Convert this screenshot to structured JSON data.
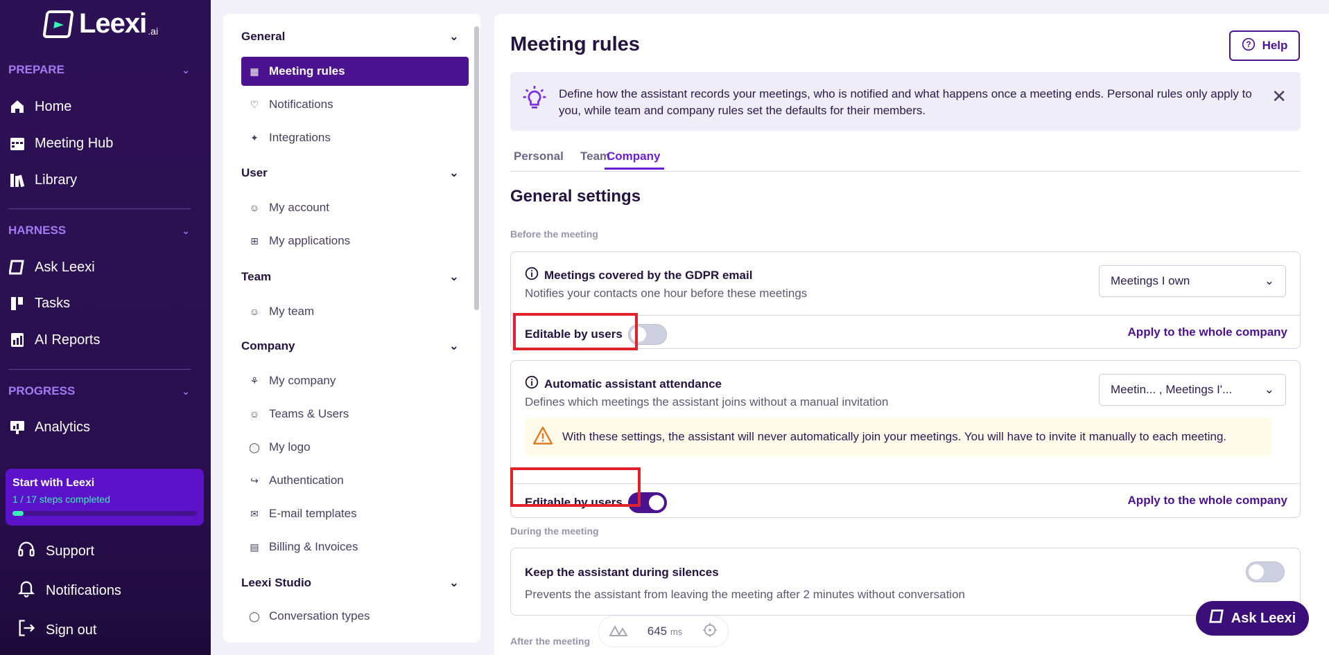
{
  "brand": {
    "name": "Leexi",
    "suffix": ".ai"
  },
  "sidebar": {
    "sections": [
      {
        "label": "PREPARE",
        "items": [
          {
            "label": "Home",
            "icon": "home-icon"
          },
          {
            "label": "Meeting Hub",
            "icon": "calendar-icon"
          },
          {
            "label": "Library",
            "icon": "library-icon"
          }
        ]
      },
      {
        "label": "HARNESS",
        "items": [
          {
            "label": "Ask Leexi",
            "icon": "leexi-icon"
          },
          {
            "label": "Tasks",
            "icon": "tasks-icon"
          },
          {
            "label": "AI Reports",
            "icon": "report-icon"
          }
        ]
      },
      {
        "label": "PROGRESS",
        "items": [
          {
            "label": "Analytics",
            "icon": "analytics-icon"
          }
        ]
      }
    ],
    "start_card": {
      "title": "Start with Leexi",
      "progress_text": "1 / 17 steps completed",
      "progress": 0.06
    },
    "bottom": [
      {
        "label": "Support",
        "icon": "headset-icon"
      },
      {
        "label": "Notifications",
        "icon": "bell-icon"
      },
      {
        "label": "Sign out",
        "icon": "sign-out-icon"
      }
    ]
  },
  "menu": {
    "sections": [
      {
        "label": "General",
        "items": [
          "Meeting rules",
          "Notifications",
          "Integrations"
        ]
      },
      {
        "label": "User",
        "items": [
          "My account",
          "My applications"
        ]
      },
      {
        "label": "Team",
        "items": [
          "My team"
        ]
      },
      {
        "label": "Company",
        "items": [
          "My company",
          "Teams & Users",
          "My logo",
          "Authentication",
          "E-mail templates",
          "Billing & Invoices"
        ]
      },
      {
        "label": "Leexi Studio",
        "items": [
          "Conversation types"
        ]
      }
    ],
    "active": "Meeting rules"
  },
  "main": {
    "title": "Meeting rules",
    "help_label": "Help",
    "info": "Define how the assistant records your meetings, who is notified and what happens once a meeting ends. Personal rules only apply to you, while team and company rules set the defaults for their members.",
    "tabs": [
      "Personal",
      "Team",
      "Company"
    ],
    "active_tab": "Company",
    "section_title": "General settings",
    "before_label": "Before the meeting",
    "during_label": "During the meeting",
    "after_label": "After the meeting",
    "gdpr": {
      "title": "Meetings covered by the GDPR email",
      "desc": "Notifies your contacts one hour before these meetings",
      "value": "Meetings I own",
      "editable_label": "Editable by users",
      "editable": false,
      "apply": "Apply to the whole company"
    },
    "attendance": {
      "title": "Automatic assistant attendance",
      "desc": "Defines which meetings the assistant joins without a manual invitation",
      "value": "Meetin... , Meetings I'...",
      "warning": "With these settings, the assistant will never automatically join your meetings. You will have to invite it manually to each meeting.",
      "editable_label": "Editable by users",
      "editable": true,
      "apply": "Apply to the whole company"
    },
    "silence": {
      "title": "Keep the assistant during silences",
      "desc": "Prevents the assistant from leaving the meeting after 2 minutes without conversation",
      "enabled": false
    }
  },
  "perf": {
    "value": "645",
    "unit": "ms"
  },
  "ask_button": "Ask Leexi"
}
